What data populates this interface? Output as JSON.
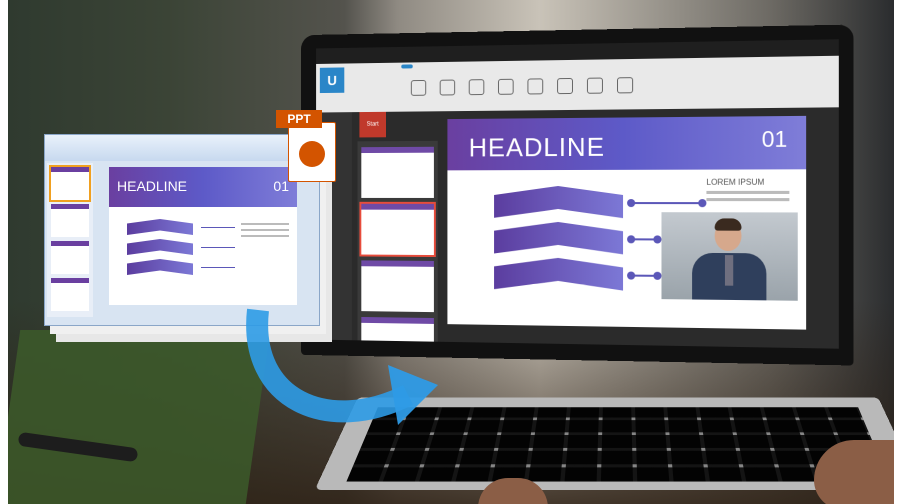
{
  "ppt_badge": "PPT",
  "laptop_slide": {
    "headline": "HEADLINE",
    "number": "01",
    "side_title": "LOREM IPSUM"
  },
  "ppt_window_slide": {
    "headline": "HEADLINE",
    "number": "01"
  },
  "app": {
    "logo": "U",
    "record_label": "Start"
  }
}
